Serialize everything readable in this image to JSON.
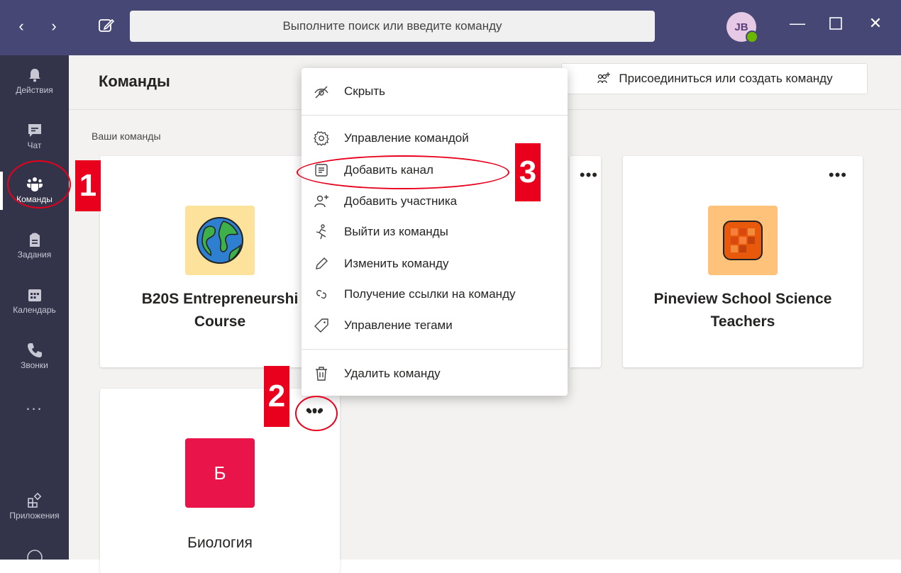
{
  "titlebar": {
    "search_placeholder": "Выполните поиск или введите команду",
    "avatar_initials": "JB"
  },
  "rail": {
    "items": [
      {
        "label": "Действия",
        "icon": "bell-icon"
      },
      {
        "label": "Чат",
        "icon": "chat-icon"
      },
      {
        "label": "Команды",
        "icon": "teams-icon"
      },
      {
        "label": "Задания",
        "icon": "assignments-icon"
      },
      {
        "label": "Календарь",
        "icon": "calendar-icon"
      },
      {
        "label": "Звонки",
        "icon": "phone-icon"
      },
      {
        "label": "...",
        "icon": "more-icon"
      },
      {
        "label": "Приложения",
        "icon": "apps-icon"
      }
    ]
  },
  "main": {
    "title": "Команды",
    "join_button": "Присоединиться или создать команду",
    "section_label": "Ваши команды",
    "teams": [
      {
        "name_line1": "B20S Entrepreneurshi",
        "name_line2": "Course",
        "tile_color": "#fce29b"
      },
      {
        "name_line1": "Pineview School Science",
        "name_line2": "Teachers",
        "tile_color": "#ffc27a"
      },
      {
        "name_line1": "Биология",
        "tile_letter": "Б",
        "tile_color": "#e8144a"
      }
    ],
    "more_label": "•••"
  },
  "menu": {
    "items": [
      {
        "label": "Скрыть",
        "icon": "hide-icon"
      },
      {
        "label": "Управление командой",
        "icon": "gear-icon"
      },
      {
        "label": "Добавить канал",
        "icon": "channel-icon"
      },
      {
        "label": "Добавить участника",
        "icon": "add-person-icon"
      },
      {
        "label": "Выйти из команды",
        "icon": "leave-icon"
      },
      {
        "label": "Изменить команду",
        "icon": "pencil-icon"
      },
      {
        "label": "Получение ссылки на команду",
        "icon": "link-icon"
      },
      {
        "label": "Управление тегами",
        "icon": "tag-icon"
      },
      {
        "label": "Удалить команду",
        "icon": "trash-icon"
      }
    ]
  },
  "annotations": {
    "step1": "1",
    "step2": "2",
    "step3": "3"
  },
  "colors": {
    "accent": "#464775",
    "rail": "#33344a",
    "annotation": "#e8001c"
  }
}
